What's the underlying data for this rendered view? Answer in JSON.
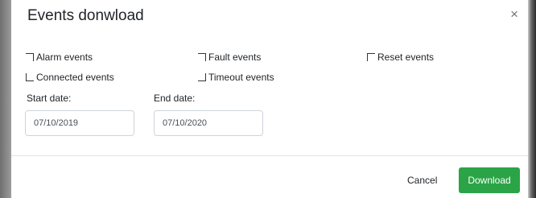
{
  "dialog": {
    "title": "Events donwload",
    "close_icon": "×"
  },
  "checkboxes": [
    {
      "label": "Alarm events",
      "checked": false
    },
    {
      "label": "Fault events",
      "checked": false
    },
    {
      "label": "Reset events",
      "checked": false
    },
    {
      "label": "Connected events",
      "checked": false
    },
    {
      "label": "Timeout events",
      "checked": false
    }
  ],
  "dates": {
    "start_label": "Start date:",
    "start_value": "07/10/2019",
    "end_label": "End date:",
    "end_value": "07/10/2020"
  },
  "footer": {
    "cancel_label": "Cancel",
    "download_label": "Download"
  },
  "colors": {
    "accent": "#2aa447"
  }
}
